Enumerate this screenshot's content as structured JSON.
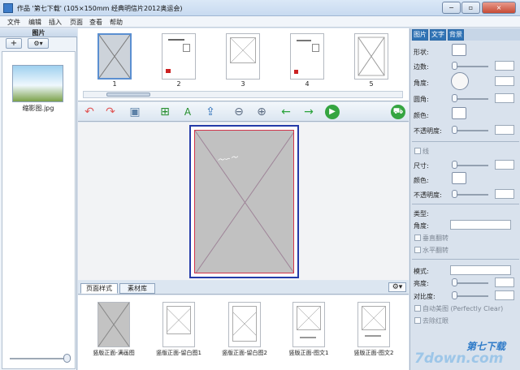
{
  "window": {
    "title": "作品 '第七下载' (105×150mm 经典明信片2012奥运会)",
    "min": "−",
    "max": "▫",
    "close": "×"
  },
  "menu": [
    "文件",
    "编辑",
    "插入",
    "页面",
    "查看",
    "帮助"
  ],
  "left_panel": {
    "title": "图片",
    "add_label": "+",
    "gear_label": "⚙▾",
    "image_name": "缩影图.jpg"
  },
  "pages": {
    "labels": [
      "1",
      "2",
      "3",
      "4",
      "5"
    ]
  },
  "toolbar": {
    "icons": [
      "undo-icon",
      "redo-icon",
      "save-icon",
      "add-image-icon",
      "add-text-icon",
      "export-icon",
      "zoom-out-icon",
      "zoom-in-icon",
      "prev-page-icon",
      "next-page-icon",
      "play-icon",
      "cart-icon"
    ]
  },
  "bottom": {
    "tabs": [
      "页面样式",
      "素材库"
    ],
    "gear_label": "⚙▾",
    "templates": [
      "竖版正面-满画图",
      "竖版正面-留白图1",
      "竖版正面-留白图2",
      "竖版正面-图文1",
      "竖版正面-图文2"
    ]
  },
  "right_panel": {
    "tabs": [
      "图片",
      "文字",
      "背景"
    ],
    "labels": {
      "shape": "形状:",
      "border": "边数:",
      "angle": "角度:",
      "corner": "圆角:",
      "color": "颜色:",
      "opacity": "不透明度:",
      "line": "线",
      "size": "尺寸:",
      "line_color": "颜色:",
      "line_opacity": "不透明度:",
      "type": "类型:",
      "type_angle": "角度:",
      "flip_v": "垂直翻转",
      "flip_h": "水平翻转",
      "mode": "模式:",
      "brightness": "亮度:",
      "contrast": "对比度:",
      "auto": "自动美图 (Perfectly Clear)",
      "redeye": "去除红眼"
    }
  },
  "watermark": {
    "text1": "第七下载",
    "text2": "7down.com"
  }
}
